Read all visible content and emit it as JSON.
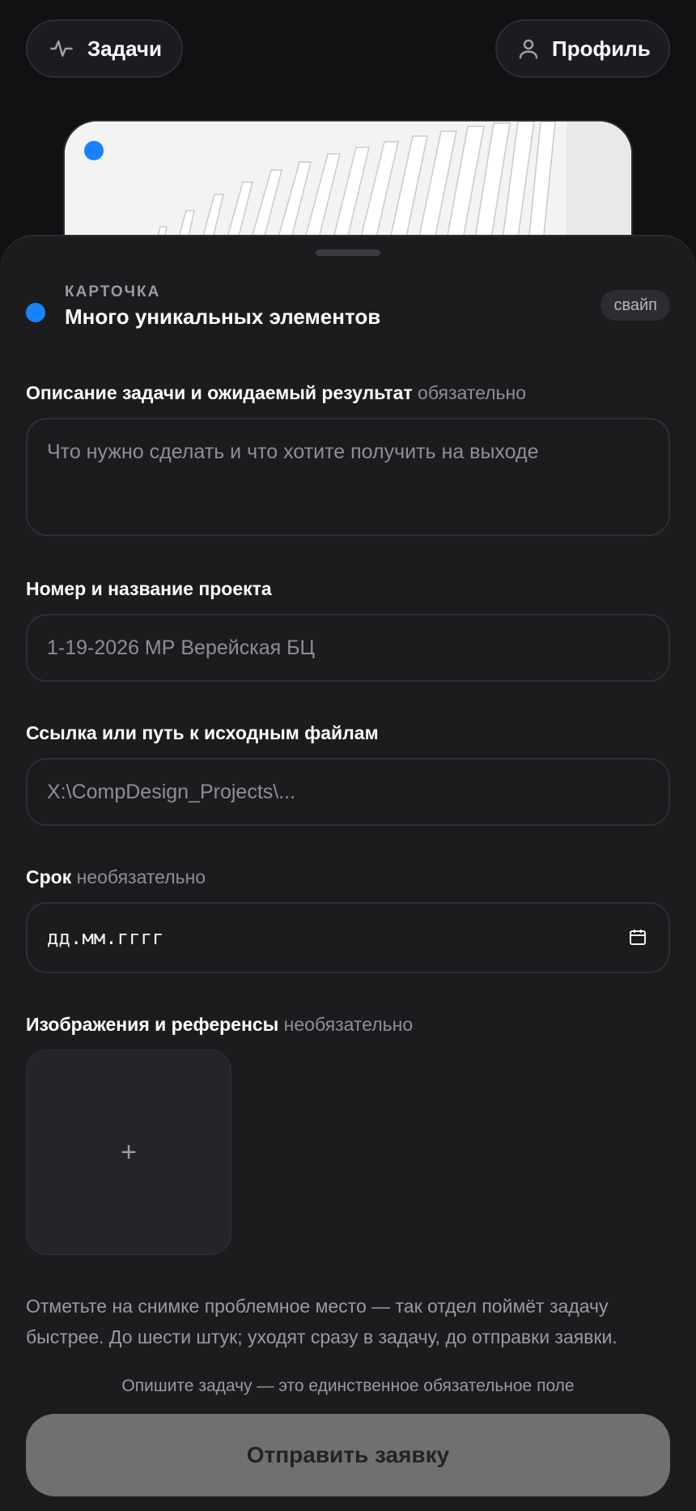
{
  "header": {
    "tasks_label": "Задачи",
    "profile_label": "Профиль"
  },
  "card": {
    "kicker": "КАРТОЧКА",
    "title": "Много уникальных элементов",
    "swipe_badge": "свайп"
  },
  "form": {
    "description": {
      "label": "Описание задачи и ожидаемый результат",
      "tag": "обязательно",
      "placeholder": "Что нужно сделать и что хотите получить на выходе"
    },
    "project": {
      "label": "Номер и название проекта",
      "placeholder": "1-19-2026 МР Верейская БЦ"
    },
    "source": {
      "label": "Ссылка или путь к исходным файлам",
      "placeholder": "X:\\CompDesign_Projects\\..."
    },
    "deadline": {
      "label": "Срок",
      "tag": "необязательно",
      "placeholder": "дд.мм.гггг"
    },
    "images": {
      "label": "Изображения и референсы",
      "tag": "необязательно",
      "add_symbol": "+"
    },
    "hint": "Отметьте на снимке проблемное место — так отдел поймёт задачу быстрее. До шести штук; уходят сразу в задачу, до отправки заявки."
  },
  "footer": {
    "required_note": "Опишите задачу — это единственное обязательное поле",
    "submit_label": "Отправить заявку"
  },
  "colors": {
    "accent": "#1a82ff",
    "background": "#111114",
    "sheet": "#1c1c1f",
    "submit_disabled": "#707070"
  }
}
